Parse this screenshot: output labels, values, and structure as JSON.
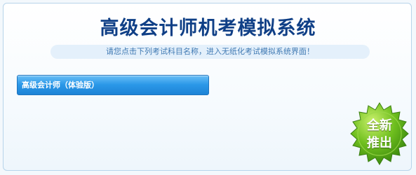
{
  "page": {
    "title": "高级会计师机考模拟系统",
    "hint": "请您点击下列考试科目名称，进入无纸化考试模拟系统界面！"
  },
  "subjects": [
    {
      "label": "高级会计师（体验版）"
    }
  ],
  "badge": {
    "line1": "全新",
    "line2": "推出"
  },
  "colors": {
    "title": "#0f3f86",
    "hint": "#3f79b3",
    "button": "#2b98e8",
    "badge": "#57ad16"
  }
}
